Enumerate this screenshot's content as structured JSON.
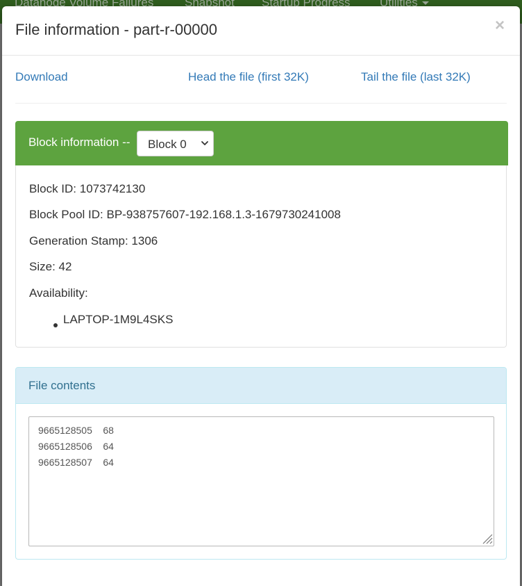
{
  "background": {
    "nav_items": [
      "Datanode Volume Failures",
      "Snapshot",
      "Startup Progress",
      "Utilities"
    ]
  },
  "modal": {
    "title": "File information - part-r-00000",
    "close_glyph": "×",
    "links": {
      "download": "Download",
      "head": "Head the file (first 32K)",
      "tail": "Tail the file (last 32K)"
    },
    "block_info": {
      "heading": "Block information --",
      "selected_block": "Block 0",
      "block_id": "Block ID: 1073742130",
      "block_pool_id": "Block Pool ID: BP-938757607-192.168.1.3-1679730241008",
      "generation_stamp": "Generation Stamp: 1306",
      "size": "Size: 42",
      "availability_label": "Availability:",
      "availability": [
        "LAPTOP-1M9L4SKS"
      ]
    },
    "file_contents": {
      "heading": "File contents",
      "lines": [
        "9665128505\t68",
        "9665128506\t64",
        "9665128507\t64"
      ]
    }
  },
  "colors": {
    "navbar_bg": "#2f5d1e",
    "block_heading_bg": "#5da33f",
    "contents_heading_bg": "#d9edf7",
    "contents_heading_text": "#31708f",
    "link": "#337ab7",
    "overlay": "#7c7c7c"
  },
  "icons": {
    "close": "close-icon",
    "select_caret": "chevron-down-icon",
    "resize": "resize-handle-icon",
    "nav_caret": "caret-down-icon"
  }
}
